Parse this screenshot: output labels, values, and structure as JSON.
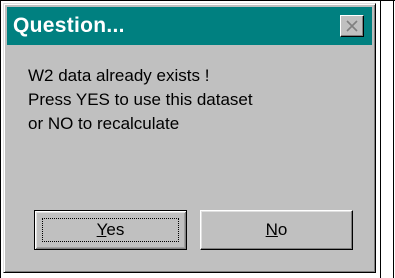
{
  "dialog": {
    "title": "Question...",
    "close_icon": "close-x-icon",
    "message_lines": [
      "W2 data already exists !",
      "Press YES to use this dataset",
      "or NO to recalculate"
    ],
    "buttons": {
      "yes": {
        "mnemonic": "Y",
        "rest": "es"
      },
      "no": {
        "mnemonic": "N",
        "rest": "o"
      }
    }
  },
  "colors": {
    "titlebar": "#008080",
    "face": "#c0c0c0"
  }
}
